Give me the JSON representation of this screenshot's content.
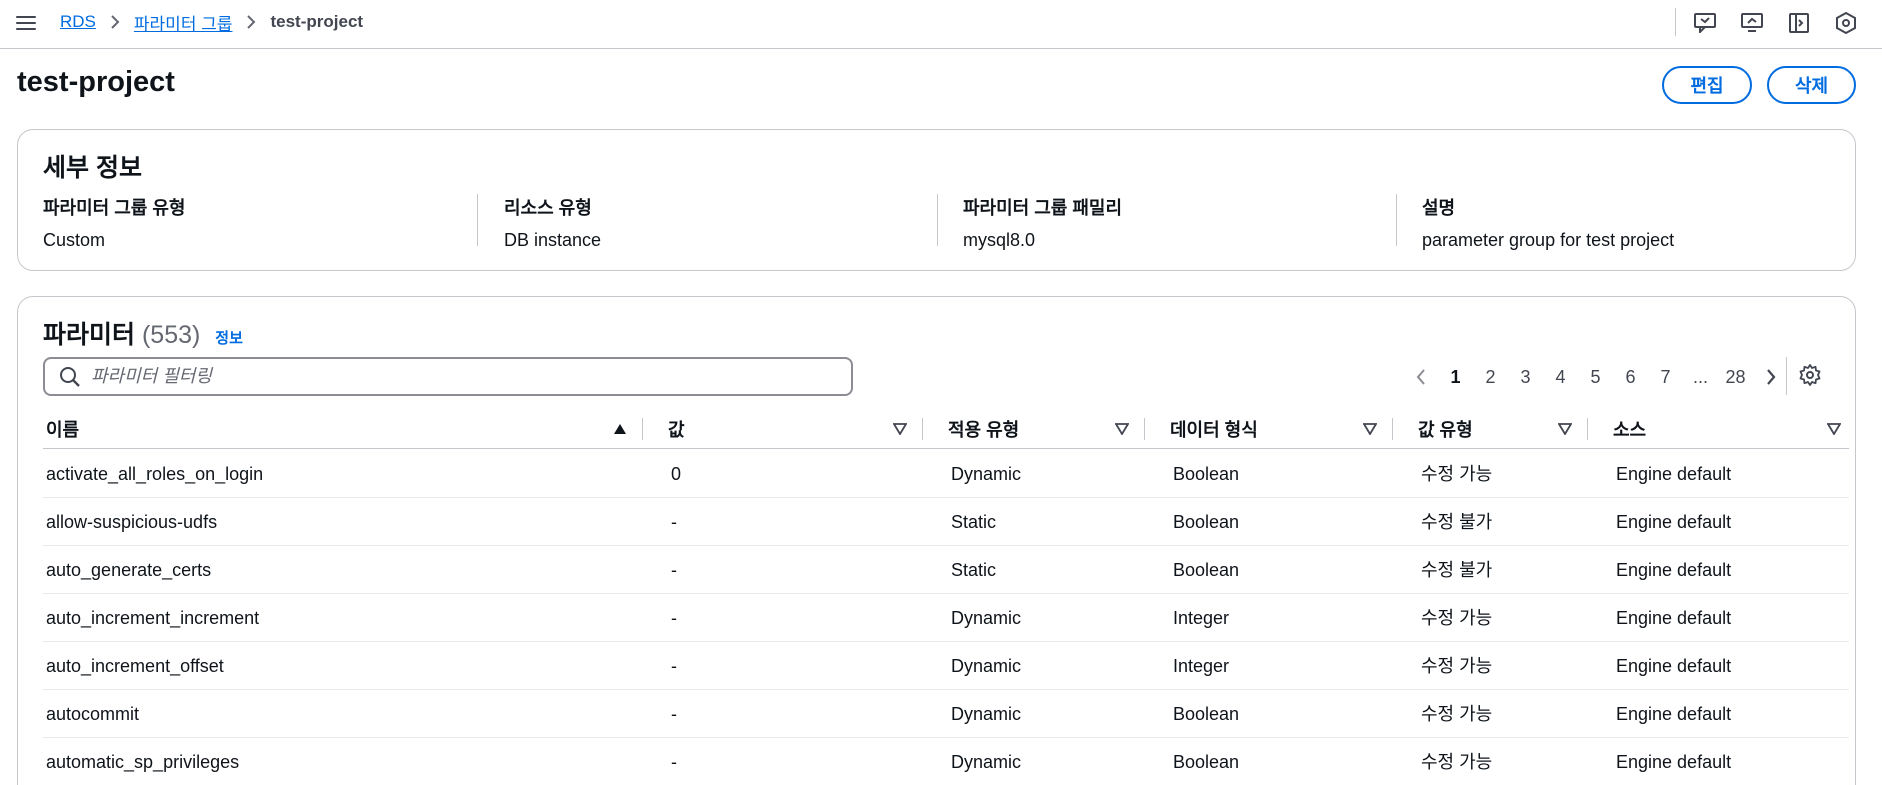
{
  "breadcrumb": {
    "items": [
      "RDS",
      "파라미터 그룹"
    ],
    "current": "test-project"
  },
  "top_icons": [
    "feedback-icon",
    "screen-icon",
    "panel-icon",
    "settings-hex-icon"
  ],
  "page": {
    "title": "test-project",
    "edit_label": "편집",
    "delete_label": "삭제"
  },
  "details": {
    "heading": "세부 정보",
    "fields": [
      {
        "label": "파라미터 그룹 유형",
        "value": "Custom"
      },
      {
        "label": "리소스 유형",
        "value": "DB instance"
      },
      {
        "label": "파라미터 그룹 패밀리",
        "value": "mysql8.0"
      },
      {
        "label": "설명",
        "value": "parameter group for test project"
      }
    ]
  },
  "parameters": {
    "heading": "파라미터",
    "count": "(553)",
    "info_label": "정보",
    "search_placeholder": "파라미터 필터링",
    "pagination": {
      "pages": [
        "1",
        "2",
        "3",
        "4",
        "5",
        "6",
        "7",
        "...",
        "28"
      ],
      "current": "1"
    },
    "columns": [
      "이름",
      "값",
      "적용 유형",
      "데이터 형식",
      "값 유형",
      "소스"
    ],
    "rows": [
      [
        "activate_all_roles_on_login",
        "0",
        "Dynamic",
        "Boolean",
        "수정 가능",
        "Engine default"
      ],
      [
        "allow-suspicious-udfs",
        "-",
        "Static",
        "Boolean",
        "수정 불가",
        "Engine default"
      ],
      [
        "auto_generate_certs",
        "-",
        "Static",
        "Boolean",
        "수정 불가",
        "Engine default"
      ],
      [
        "auto_increment_increment",
        "-",
        "Dynamic",
        "Integer",
        "수정 가능",
        "Engine default"
      ],
      [
        "auto_increment_offset",
        "-",
        "Dynamic",
        "Integer",
        "수정 가능",
        "Engine default"
      ],
      [
        "autocommit",
        "-",
        "Dynamic",
        "Boolean",
        "수정 가능",
        "Engine default"
      ],
      [
        "automatic_sp_privileges",
        "-",
        "Dynamic",
        "Boolean",
        "수정 가능",
        "Engine default"
      ]
    ]
  },
  "colors": {
    "link": "#006ce0",
    "border": "#c6c6cd",
    "text": "#0f141a",
    "muted": "#656871"
  }
}
